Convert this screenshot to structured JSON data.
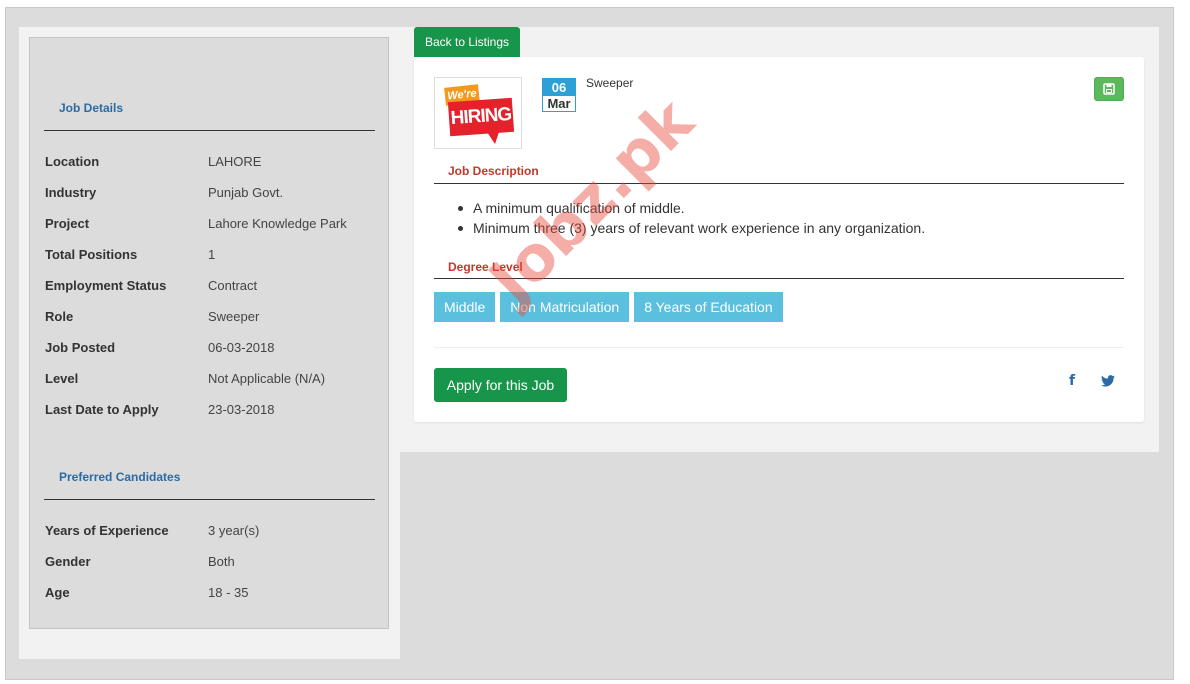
{
  "back_button": "Back to Listings",
  "sidebar": {
    "job_details_heading": "Job Details",
    "job_details": [
      {
        "label": "Location",
        "value": "LAHORE"
      },
      {
        "label": "Industry",
        "value": "Punjab Govt."
      },
      {
        "label": "Project",
        "value": "Lahore Knowledge Park"
      },
      {
        "label": "Total Positions",
        "value": "1"
      },
      {
        "label": "Employment Status",
        "value": "Contract"
      },
      {
        "label": "Role",
        "value": "Sweeper"
      },
      {
        "label": "Job Posted",
        "value": "06-03-2018"
      },
      {
        "label": "Level",
        "value": "Not Applicable (N/A)"
      },
      {
        "label": "Last Date to Apply",
        "value": "23-03-2018"
      }
    ],
    "preferred_heading": "Preferred Candidates",
    "preferred": [
      {
        "label": "Years of Experience",
        "value": "3 year(s)"
      },
      {
        "label": "Gender",
        "value": "Both"
      },
      {
        "label": "Age",
        "value": "18 - 35"
      }
    ]
  },
  "job": {
    "logo_text_top": "We're",
    "logo_text_main": "HIRING",
    "date_day": "06",
    "date_month": "Mar",
    "title": "Sweeper",
    "save_icon": "floppy-disk-icon",
    "description_heading": "Job Description",
    "description": [
      "A minimum qualification of middle.",
      "Minimum three (3) years of relevant work experience in any organization."
    ],
    "degree_heading": "Degree Level",
    "degrees": [
      "Middle",
      "Non Matriculation",
      "8 Years of Education"
    ],
    "apply_button": "Apply for this Job",
    "share_facebook": "f",
    "share_twitter_icon": "twitter-icon"
  },
  "watermark": "Jobz.pk",
  "colors": {
    "primary_green": "#17954a",
    "tag_blue": "#5bc0de",
    "heading_red": "#c0392b",
    "link_blue": "#2b6aa3"
  }
}
